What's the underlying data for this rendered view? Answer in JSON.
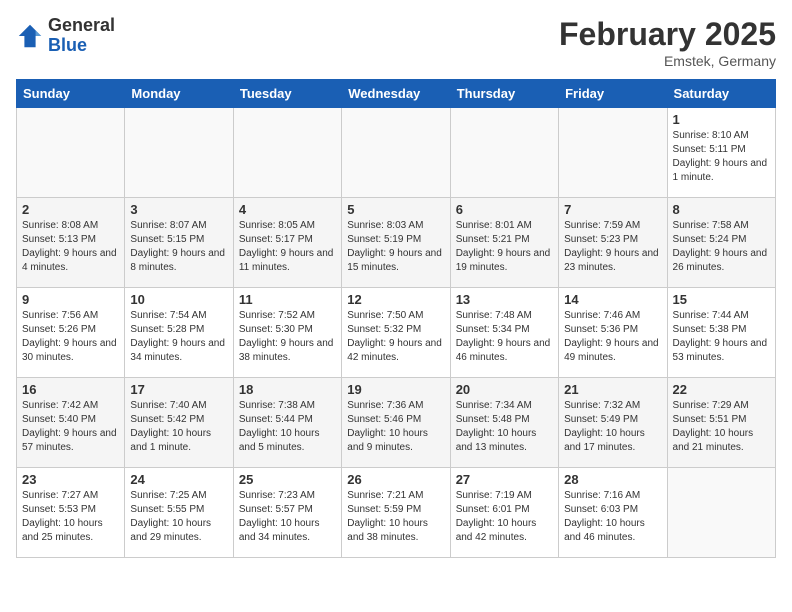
{
  "header": {
    "logo_general": "General",
    "logo_blue": "Blue",
    "month_title": "February 2025",
    "subtitle": "Emstek, Germany"
  },
  "weekdays": [
    "Sunday",
    "Monday",
    "Tuesday",
    "Wednesday",
    "Thursday",
    "Friday",
    "Saturday"
  ],
  "weeks": [
    [
      {
        "day": "",
        "info": ""
      },
      {
        "day": "",
        "info": ""
      },
      {
        "day": "",
        "info": ""
      },
      {
        "day": "",
        "info": ""
      },
      {
        "day": "",
        "info": ""
      },
      {
        "day": "",
        "info": ""
      },
      {
        "day": "1",
        "info": "Sunrise: 8:10 AM\nSunset: 5:11 PM\nDaylight: 9 hours and 1 minute."
      }
    ],
    [
      {
        "day": "2",
        "info": "Sunrise: 8:08 AM\nSunset: 5:13 PM\nDaylight: 9 hours and 4 minutes."
      },
      {
        "day": "3",
        "info": "Sunrise: 8:07 AM\nSunset: 5:15 PM\nDaylight: 9 hours and 8 minutes."
      },
      {
        "day": "4",
        "info": "Sunrise: 8:05 AM\nSunset: 5:17 PM\nDaylight: 9 hours and 11 minutes."
      },
      {
        "day": "5",
        "info": "Sunrise: 8:03 AM\nSunset: 5:19 PM\nDaylight: 9 hours and 15 minutes."
      },
      {
        "day": "6",
        "info": "Sunrise: 8:01 AM\nSunset: 5:21 PM\nDaylight: 9 hours and 19 minutes."
      },
      {
        "day": "7",
        "info": "Sunrise: 7:59 AM\nSunset: 5:23 PM\nDaylight: 9 hours and 23 minutes."
      },
      {
        "day": "8",
        "info": "Sunrise: 7:58 AM\nSunset: 5:24 PM\nDaylight: 9 hours and 26 minutes."
      }
    ],
    [
      {
        "day": "9",
        "info": "Sunrise: 7:56 AM\nSunset: 5:26 PM\nDaylight: 9 hours and 30 minutes."
      },
      {
        "day": "10",
        "info": "Sunrise: 7:54 AM\nSunset: 5:28 PM\nDaylight: 9 hours and 34 minutes."
      },
      {
        "day": "11",
        "info": "Sunrise: 7:52 AM\nSunset: 5:30 PM\nDaylight: 9 hours and 38 minutes."
      },
      {
        "day": "12",
        "info": "Sunrise: 7:50 AM\nSunset: 5:32 PM\nDaylight: 9 hours and 42 minutes."
      },
      {
        "day": "13",
        "info": "Sunrise: 7:48 AM\nSunset: 5:34 PM\nDaylight: 9 hours and 46 minutes."
      },
      {
        "day": "14",
        "info": "Sunrise: 7:46 AM\nSunset: 5:36 PM\nDaylight: 9 hours and 49 minutes."
      },
      {
        "day": "15",
        "info": "Sunrise: 7:44 AM\nSunset: 5:38 PM\nDaylight: 9 hours and 53 minutes."
      }
    ],
    [
      {
        "day": "16",
        "info": "Sunrise: 7:42 AM\nSunset: 5:40 PM\nDaylight: 9 hours and 57 minutes."
      },
      {
        "day": "17",
        "info": "Sunrise: 7:40 AM\nSunset: 5:42 PM\nDaylight: 10 hours and 1 minute."
      },
      {
        "day": "18",
        "info": "Sunrise: 7:38 AM\nSunset: 5:44 PM\nDaylight: 10 hours and 5 minutes."
      },
      {
        "day": "19",
        "info": "Sunrise: 7:36 AM\nSunset: 5:46 PM\nDaylight: 10 hours and 9 minutes."
      },
      {
        "day": "20",
        "info": "Sunrise: 7:34 AM\nSunset: 5:48 PM\nDaylight: 10 hours and 13 minutes."
      },
      {
        "day": "21",
        "info": "Sunrise: 7:32 AM\nSunset: 5:49 PM\nDaylight: 10 hours and 17 minutes."
      },
      {
        "day": "22",
        "info": "Sunrise: 7:29 AM\nSunset: 5:51 PM\nDaylight: 10 hours and 21 minutes."
      }
    ],
    [
      {
        "day": "23",
        "info": "Sunrise: 7:27 AM\nSunset: 5:53 PM\nDaylight: 10 hours and 25 minutes."
      },
      {
        "day": "24",
        "info": "Sunrise: 7:25 AM\nSunset: 5:55 PM\nDaylight: 10 hours and 29 minutes."
      },
      {
        "day": "25",
        "info": "Sunrise: 7:23 AM\nSunset: 5:57 PM\nDaylight: 10 hours and 34 minutes."
      },
      {
        "day": "26",
        "info": "Sunrise: 7:21 AM\nSunset: 5:59 PM\nDaylight: 10 hours and 38 minutes."
      },
      {
        "day": "27",
        "info": "Sunrise: 7:19 AM\nSunset: 6:01 PM\nDaylight: 10 hours and 42 minutes."
      },
      {
        "day": "28",
        "info": "Sunrise: 7:16 AM\nSunset: 6:03 PM\nDaylight: 10 hours and 46 minutes."
      },
      {
        "day": "",
        "info": ""
      }
    ]
  ]
}
